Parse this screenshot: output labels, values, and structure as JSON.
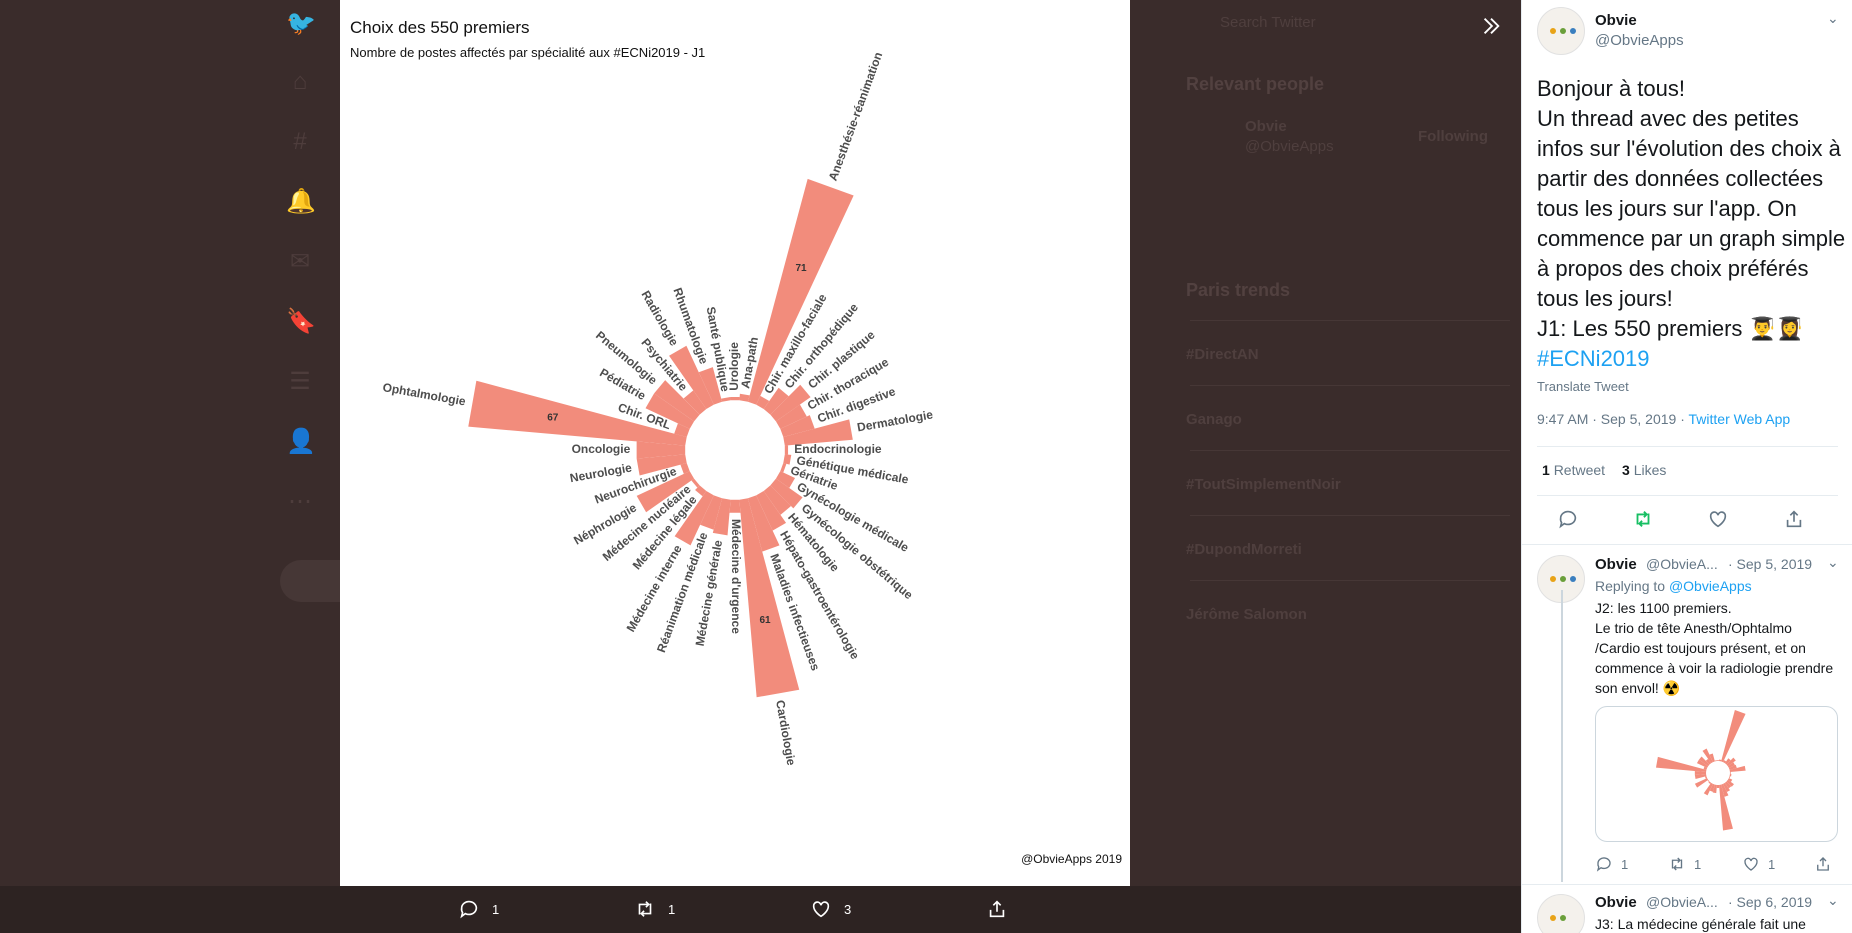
{
  "chart_data": {
    "type": "polar-bar",
    "title": "Choix des 550 premiers",
    "subtitle": "Nombre de postes affectés par spécialité aux #ECNi2019 - J1",
    "credit": "@ObvieApps 2019",
    "bar_color": "#f28c7c",
    "categories": [
      "Ana-path",
      "Anesthésie-réanimation",
      "Chir. maxillo-faciale",
      "Chir. orthopédique",
      "Chir. plastique",
      "Chir. thoracique",
      "Chir. digestive",
      "Dermatologie",
      "Endocrinologie",
      "Génétique médicale",
      "Gériatrie",
      "Gynécologie médicale",
      "Gynécologie obstétrique",
      "Hématologie",
      "Hépato-gastroentérologie",
      "Maladies infectieuses",
      "Cardiologie",
      "Médecine d'urgence",
      "Médecine générale",
      "Réanimation médicale",
      "Médecine interne",
      "Médecine légale",
      "Médecine nucléaire",
      "Néphrologie",
      "Neurochirurgie",
      "Neurologie",
      "Oncologie",
      "Ophtalmologie",
      "Chir. ORL",
      "Pédiatrie",
      "Pneumologie",
      "Psychiatrie",
      "Radiologie",
      "Rhumatologie",
      "Santé publique",
      "Urologie"
    ],
    "values": [
      2,
      71,
      3,
      8,
      13,
      9,
      10,
      21,
      1,
      2,
      1,
      5,
      10,
      9,
      12,
      17,
      61,
      4,
      11,
      10,
      17,
      2,
      1,
      18,
      2,
      15,
      15,
      67,
      4,
      15,
      15,
      7,
      20,
      11,
      1,
      1
    ],
    "labeled_values": {
      "Anesthésie-réanimation": "71",
      "Ophtalmologie": "67",
      "Cardiologie": "61"
    }
  },
  "overlay": {
    "expand_icon": "double-chevron-right-icon",
    "reply_count": "1",
    "retweet_count": "1",
    "like_count": "3"
  },
  "sidebar": {
    "main_tweet": {
      "name": "Obvie",
      "handle": "@ObvieApps",
      "text_lines": [
        "Bonjour à tous!",
        "Un thread avec des petites infos sur l'évolution des choix à partir des données collectées tous les jours sur l'app. On commence par un graph simple à propos des choix préférés tous les jours!",
        "J1: Les 550 premiers 👨‍🎓👩‍🎓"
      ],
      "hashtag": "#ECNi2019",
      "translate": "Translate Tweet",
      "timestamp": "9:47 AM · Sep 5, 2019 · ",
      "source": "Twitter Web App",
      "retweets_count": "1",
      "retweets_label": "Retweet",
      "likes_count": "3",
      "likes_label": "Likes"
    },
    "reply1": {
      "name": "Obvie",
      "handle": "@ObvieA...",
      "date": "· Sep 5, 2019",
      "replying_to_label": "Replying to ",
      "replying_to": "@ObvieApps",
      "text": "J2: les 1100 premiers.\nLe trio de tête Anesth/Ophtalmo /Cardio est toujours présent, et on commence à voir la radiologie prendre son envol! ☢️",
      "reply_count": "1",
      "retweet_count": "1",
      "like_count": "1"
    },
    "reply2": {
      "name": "Obvie",
      "handle": "@ObvieA...",
      "date": "· Sep 6, 2019",
      "text": "J3: La médecine générale fait une"
    }
  },
  "background": {
    "search_placeholder": "Search Twitter",
    "relevant_people": "Relevant people",
    "person_name": "Obvie",
    "person_handle": "@ObvieApps",
    "follow_label": "Following",
    "trends_title": "Paris trends",
    "trends": [
      "#DirectAN",
      "Ganago",
      "#ToutSimplementNoir",
      "#DupondMorreti",
      "Jérôme Salomon"
    ]
  }
}
